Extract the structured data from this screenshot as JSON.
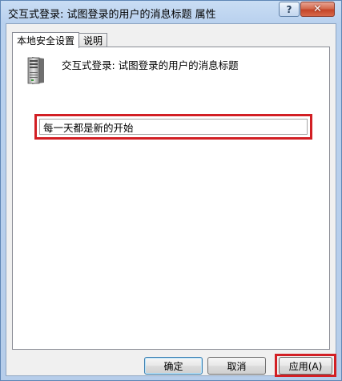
{
  "window": {
    "title": "交互式登录: 试图登录的用户的消息标题 属性",
    "help_glyph": "?",
    "close_glyph": "✕"
  },
  "tabs": [
    {
      "label": "本地安全设置",
      "active": true
    },
    {
      "label": "说明",
      "active": false
    }
  ],
  "policy": {
    "icon": "server-icon",
    "name": "交互式登录: 试图登录的用户的消息标题"
  },
  "message_input": {
    "value": "每一天都是新的开始"
  },
  "buttons": {
    "ok": "确定",
    "cancel": "取消",
    "apply": "应用(A)"
  },
  "colors": {
    "highlight": "#d21f24",
    "title_bar": "#b9d1ee",
    "close_button": "#c44528"
  }
}
